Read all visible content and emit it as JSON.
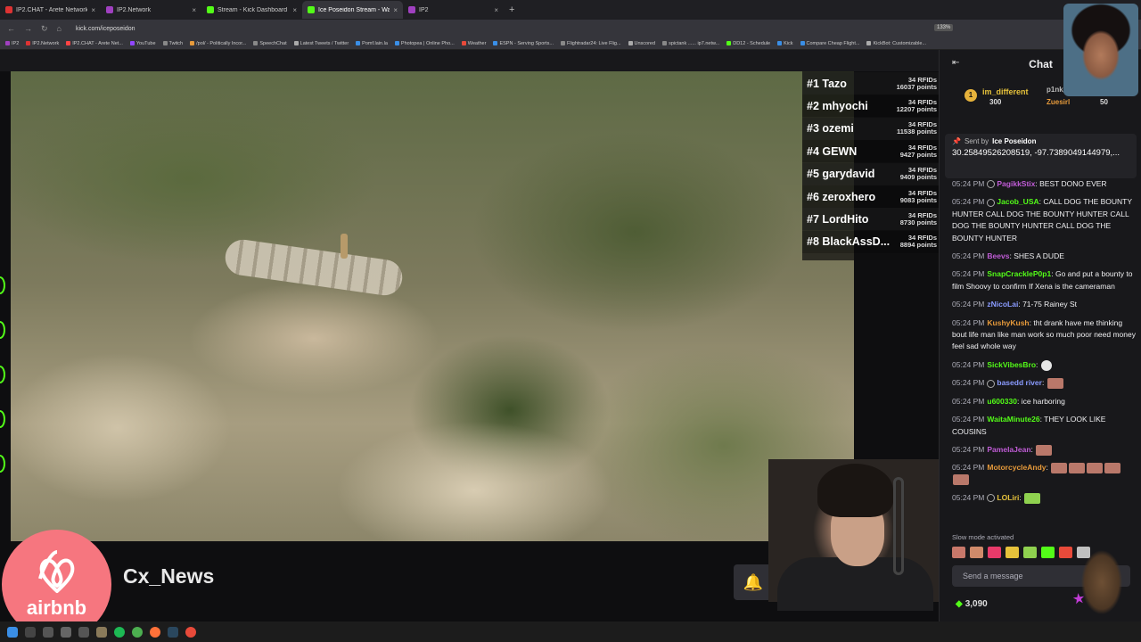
{
  "browser": {
    "tabs": [
      {
        "label": "IP2.CHAT - Arete Network",
        "fav_color": "#d33"
      },
      {
        "label": "IP2.Network",
        "fav_color": "#a040c0"
      },
      {
        "label": "Stream - Kick Dashboard",
        "fav_color": "#53fc18"
      },
      {
        "label": "Ice Poseidon Stream - Wa",
        "fav_color": "#53fc18"
      },
      {
        "label": "IP2",
        "fav_color": "#a040c0"
      }
    ],
    "close": "×",
    "new_tab": "+",
    "url": "kick.com/iceposeidon",
    "zoom": "133%",
    "bookmarks": [
      "IP2",
      "IP2.Network",
      "IP2.CHAT - Arete Net...",
      "YouTube",
      "Twitch",
      "/pol/ - Politically Incor...",
      "SpeechChat",
      "Latest Tweets / Twitter",
      "Pomf.lain.la",
      "Photopea | Online Pho...",
      "Weather",
      "ESPN - Serving Sports...",
      "Flightradar24: Live Flig...",
      "Unscored",
      "spictank ...... ip7.netw...",
      "DD12 - Schedule",
      "Kick",
      "Compare Cheap Flight...",
      "KickBot: Customizable..."
    ]
  },
  "leaderboard": [
    {
      "rank_name": "#1 Tazo",
      "rfids": "34 RFIDs",
      "points": "16037 points"
    },
    {
      "rank_name": "#2 mhyochi",
      "rfids": "34 RFIDs",
      "points": "12207 points"
    },
    {
      "rank_name": "#3 ozemi",
      "rfids": "34 RFIDs",
      "points": "11538 points"
    },
    {
      "rank_name": "#4 GEWN",
      "rfids": "34 RFIDs",
      "points": "9427 points"
    },
    {
      "rank_name": "#5 garydavid",
      "rfids": "34 RFIDs",
      "points": "9409 points"
    },
    {
      "rank_name": "#6 zeroxhero",
      "rfids": "34 RFIDs",
      "points": "9083 points"
    },
    {
      "rank_name": "#7 LordHito",
      "rfids": "34 RFIDs",
      "points": "8730 points"
    },
    {
      "rank_name": "#8 BlackAssD...",
      "rfids": "34 RFIDs",
      "points": "8894 points"
    }
  ],
  "stream": {
    "channel_name": "Cx_News",
    "ad_brand": "airbnb"
  },
  "chat": {
    "title": "Chat",
    "gifters": [
      {
        "rank": "1",
        "name": "im_different",
        "count": "300"
      },
      {
        "name": "p1nk_"
      },
      {
        "name": "Zuesirl",
        "count": "50"
      }
    ],
    "pinned": {
      "sent_by_label": "Sent by",
      "owner": "Ice Poseidon",
      "message": "30.25849526208519, -97.7389049144979,..."
    },
    "messages": [
      {
        "time": "05:24 PM",
        "user": "PagikkStix",
        "color": "#c05cd6",
        "text": "BEST DONO EVER"
      },
      {
        "time": "05:24 PM",
        "user": "Jacob_USA",
        "color": "#53fc18",
        "text": "CALL DOG THE BOUNTY HUNTER CALL DOG THE BOUNTY HUNTER CALL DOG THE BOUNTY HUNTER CALL DOG THE BOUNTY HUNTER"
      },
      {
        "time": "05:24 PM",
        "user": "Beevs",
        "color": "#c05cd6",
        "text": "SHES A DUDE"
      },
      {
        "time": "05:24 PM",
        "user": "SnapCrackleP0p1",
        "color": "#53fc18",
        "text": "Go and put a bounty to film Shoovy to confirm If Xena is the cameraman"
      },
      {
        "time": "05:24 PM",
        "user": "zNicoLai",
        "color": "#8a9bff",
        "text": "71-75 Rainey St"
      },
      {
        "time": "05:24 PM",
        "user": "KushyKush",
        "color": "#e69a3b",
        "text": "tht drank have me thinking bout life man like man work so much poor need money feel sad whole way"
      },
      {
        "time": "05:24 PM",
        "user": "SickVibesBro",
        "color": "#53fc18",
        "text": ""
      },
      {
        "time": "05:24 PM",
        "user": "basedd river",
        "color": "#8a9bff",
        "text": ""
      },
      {
        "time": "05:24 PM",
        "user": "u600330",
        "color": "#53fc18",
        "text": "ice harboring"
      },
      {
        "time": "05:24 PM",
        "user": "WaitaMinute26",
        "color": "#53fc18",
        "text": "THEY LOOK LIKE COUSINS"
      },
      {
        "time": "05:24 PM",
        "user": "PamelaJean",
        "color": "#c05cd6",
        "text": ""
      },
      {
        "time": "05:24 PM",
        "user": "MotorcycleAndy",
        "color": "#e69a3b",
        "text": ""
      },
      {
        "time": "05:24 PM",
        "user": "LOLiri",
        "color": "#e6c23b",
        "text": ""
      }
    ],
    "slow_mode": "Slow mode activated",
    "input_placeholder": "Send a message",
    "points": "3,090"
  }
}
